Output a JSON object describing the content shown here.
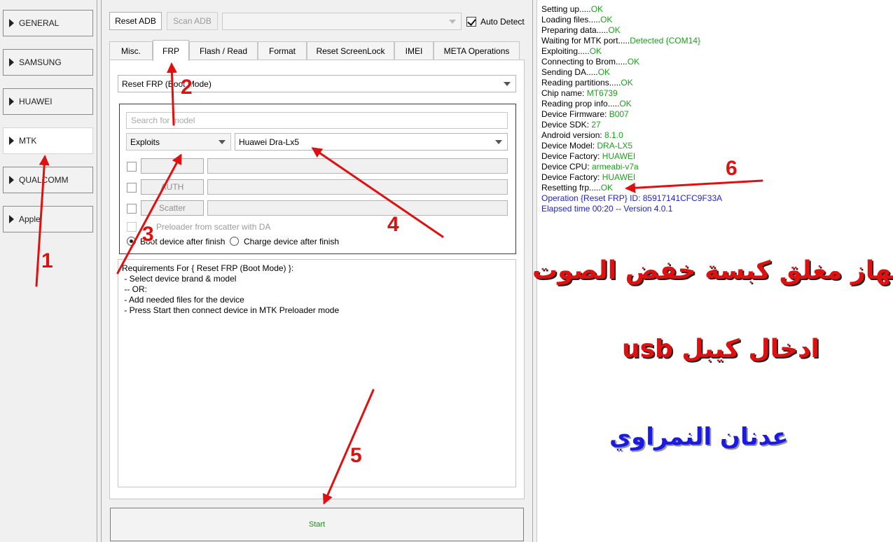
{
  "nav": {
    "items": [
      {
        "label": "GENERAL"
      },
      {
        "label": "SAMSUNG"
      },
      {
        "label": "HUAWEI"
      },
      {
        "label": "MTK"
      },
      {
        "label": "QUALCOMM"
      },
      {
        "label": "Apple"
      }
    ],
    "active": "MTK"
  },
  "toolbar": {
    "reset_adb": "Reset ADB",
    "scan_adb": "Scan ADB",
    "device_combo_value": "",
    "auto_detect_label": "Auto Detect",
    "auto_detect_checked": true
  },
  "tabs": [
    {
      "label": "Misc."
    },
    {
      "label": "FRP"
    },
    {
      "label": "Flash / Read"
    },
    {
      "label": "Format"
    },
    {
      "label": "Reset ScreenLock"
    },
    {
      "label": "IMEI"
    },
    {
      "label": "META Operations"
    }
  ],
  "frp": {
    "operation_value": "Reset FRP (Boot Mode)",
    "search_placeholder": "Search for model",
    "brand_value": "Exploits",
    "model_value": "Huawei Dra-Lx5",
    "file_buttons": [
      "",
      "AUTH",
      "Scatter"
    ],
    "preloader_label": "Preloader from scatter with DA",
    "boot_label": "Boot device after finish",
    "charge_label": "Charge device after finish"
  },
  "requirements": {
    "title": "Requirements For { Reset FRP (Boot Mode) }:",
    "lines": [
      " - Select device brand & model",
      " -- OR:",
      " - Add needed files for the device",
      " - Press Start then connect device in MTK Preloader mode"
    ]
  },
  "start_label": "Start",
  "log": [
    {
      "text": "Setting up.....",
      "value": "OK",
      "cls": "ok"
    },
    {
      "text": "Loading files.....",
      "value": "OK",
      "cls": "ok"
    },
    {
      "text": "Preparing data.....",
      "value": "OK",
      "cls": "ok"
    },
    {
      "text": "Waiting for MTK port.....",
      "value": "Detected {COM14}",
      "cls": "ok"
    },
    {
      "text": "Exploiting.....",
      "value": "OK",
      "cls": "ok"
    },
    {
      "text": "Connecting to Brom.....",
      "value": "OK",
      "cls": "ok"
    },
    {
      "text": "Sending DA.....",
      "value": "OK",
      "cls": "ok"
    },
    {
      "text": "Reading partitions.....",
      "value": "OK",
      "cls": "ok"
    },
    {
      "text": "Chip name: ",
      "value": "MT6739",
      "cls": "ok"
    },
    {
      "text": "Reading prop info.....",
      "value": "OK",
      "cls": "ok"
    },
    {
      "text": "Device Firmware: ",
      "value": "B007",
      "cls": "ok"
    },
    {
      "text": "Device SDK: ",
      "value": "27",
      "cls": "ok"
    },
    {
      "text": "Android version: ",
      "value": "8.1.0",
      "cls": "ok"
    },
    {
      "text": "Device Model: ",
      "value": "DRA-LX5",
      "cls": "ok"
    },
    {
      "text": "Device Factory: ",
      "value": "HUAWEI",
      "cls": "ok"
    },
    {
      "text": "Device CPU: ",
      "value": "armeabi-v7a",
      "cls": "ok"
    },
    {
      "text": "Device Factory: ",
      "value": "HUAWEI",
      "cls": "ok"
    },
    {
      "text": "Resetting frp.....",
      "value": "OK",
      "cls": "ok"
    },
    {
      "text": "",
      "value": "Operation {Reset FRP} ID: 85917141CFC9F33A",
      "cls": "blu"
    },
    {
      "text": "",
      "value": "Elapsed time 00:20 -- Version 4.0.1",
      "cls": "blu"
    }
  ],
  "annotations": {
    "arabic_1": "الجهاز مغلق كبسة خفض الصوت",
    "arabic_2": "ادخال كيبل usb",
    "arabic_3": "عدنان النمراوي",
    "numbers": [
      "1",
      "2",
      "3",
      "4",
      "5",
      "6"
    ],
    "colors": {
      "annotation_red": "#e01010",
      "annotation_blue": "#1a1ae0",
      "ok_green": "#1aa21a",
      "info_blue": "#1f22c8"
    }
  }
}
